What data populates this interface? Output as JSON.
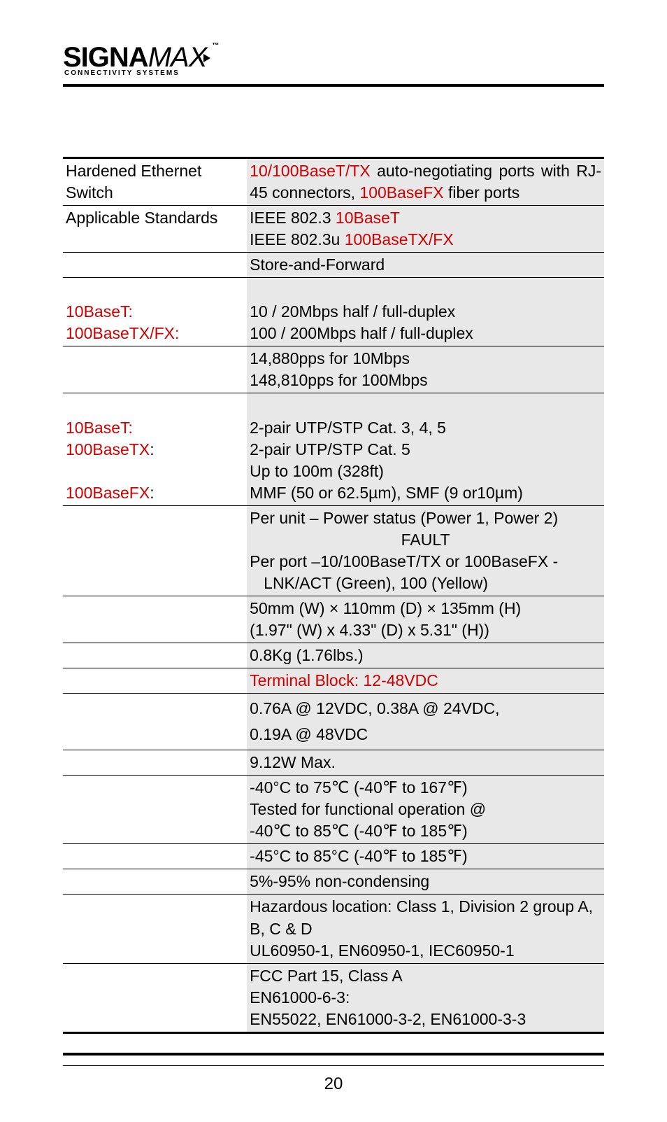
{
  "logo": {
    "brand_bold": "SIGNA",
    "brand_thin": "MAX",
    "tm": "™",
    "sub": "CONNECTIVITY SYSTEMS"
  },
  "rows": {
    "hardened": {
      "label": "Hardened Ethernet Switch",
      "val_a": "10/100BaseT/TX",
      "val_b": " auto-negotiating ports with RJ-45 connectors, ",
      "val_c": "100BaseFX",
      "val_d": " fiber ports"
    },
    "standards": {
      "label": "Applicable Standards",
      "line1a": "IEEE 802.3 ",
      "line1b": "10BaseT",
      "line2a": "IEEE 802.3u ",
      "line2b": "100BaseTX/FX"
    },
    "store": {
      "value": "Store-and-Forward"
    },
    "duplex": {
      "l1": "10BaseT:",
      "l2": "100BaseTX/FX:",
      "v1": "10 / 20Mbps half / full-duplex",
      "v2": "100 / 200Mbps half / full-duplex"
    },
    "pps": {
      "v1": "14,880pps for 10Mbps",
      "v2": "148,810pps for 100Mbps"
    },
    "cable": {
      "l1": "10BaseT:",
      "l2": "100BaseTX",
      "l2c": ":",
      "l3": "100BaseFX",
      "l3c": ":",
      "v1": "2-pair UTP/STP Cat. 3, 4, 5",
      "v2": "2-pair UTP/STP Cat. 5",
      "v3": "Up to 100m (328ft)",
      "v4": "MMF (50 or 62.5µm), SMF (9 or10µm)"
    },
    "led": {
      "v1": "Per unit – Power status (Power 1, Power 2)",
      "v2": "FAULT",
      "v3": "Per port –10/100BaseT/TX or 100BaseFX -",
      "v4": "LNK/ACT (Green), 100 (Yellow)"
    },
    "dim": {
      "v1": "50mm (W) × 110mm (D) × 135mm (H)",
      "v2": "(1.97\" (W) x 4.33\" (D) x 5.31\" (H))"
    },
    "weight": {
      "v": "0.8Kg (1.76lbs.)"
    },
    "power": {
      "v": "Terminal Block: 12-48VDC"
    },
    "current": {
      "v1": "0.76A @ 12VDC, 0.38A @ 24VDC,",
      "v2": "0.19A @ 48VDC"
    },
    "watts": {
      "v": "9.12W Max."
    },
    "optemp": {
      "v1": "-40°C to 75℃ (-40℉ to 167℉)",
      "v2": "Tested for functional operation @",
      "v3": "-40℃ to 85℃ (-40℉ to 185℉)"
    },
    "sttemp": {
      "v": "-45°C to 85°C (-40℉ to 185℉)"
    },
    "humid": {
      "v": "5%-95% non-condensing"
    },
    "safety": {
      "v1": "Hazardous location: Class 1, Division 2 group A, B, C & D",
      "v2": "UL60950-1, EN60950-1, IEC60950-1"
    },
    "emc": {
      "v1": "FCC Part 15, Class A",
      "v2": "EN61000-6-3:",
      "v3": "EN55022, EN61000-3-2, EN61000-3-3"
    }
  },
  "page_number": "20"
}
